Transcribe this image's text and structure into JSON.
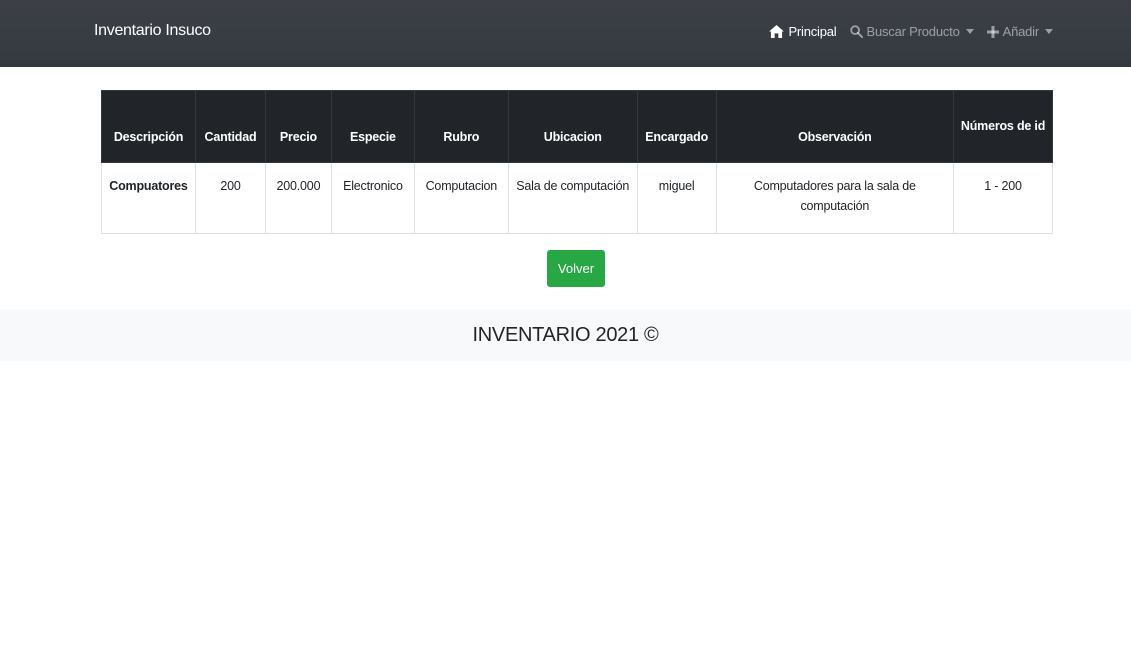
{
  "navbar": {
    "brand": "Inventario Insuco",
    "links": [
      {
        "label": "Principal",
        "icon": "home-icon",
        "active": true
      },
      {
        "label": "Buscar Producto",
        "icon": "search-icon",
        "dropdown": true
      },
      {
        "label": "Añadir",
        "icon": "plus-icon",
        "dropdown": true
      }
    ]
  },
  "table": {
    "headers": [
      "Descripción",
      "Cantidad",
      "Precio",
      "Especie",
      "Rubro",
      "Ubicacion",
      "Encargado",
      "Observación",
      "Números de id"
    ],
    "rows": [
      [
        "Compuatores",
        "200",
        "200.000",
        "Electronico",
        "Computacion",
        "Sala de computación",
        "miguel",
        "Computadores para la sala de computación",
        "1 - 200"
      ]
    ]
  },
  "actions": {
    "back_label": "Volver"
  },
  "footer": {
    "text": "INVENTARIO 2021 ©"
  },
  "colors": {
    "navbar_bg": "#343a40",
    "table_header_bg": "#212529",
    "button_success": "#28a745",
    "footer_bg": "#f8f9fa"
  }
}
